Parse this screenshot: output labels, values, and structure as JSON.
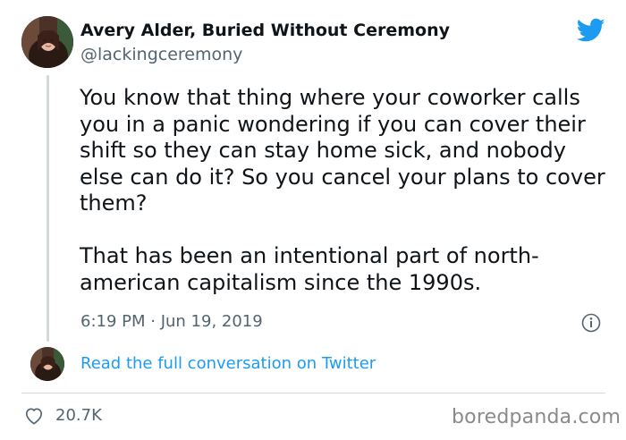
{
  "author": {
    "display_name": "Avery Alder, Buried Without Ceremony",
    "handle": "@lackingceremony"
  },
  "tweet": {
    "paragraphs": [
      "You know that thing where your coworker calls you in a panic wondering if you can cover their shift so they can stay home sick, and nobody else can do it? So you cancel your plans to cover them?",
      "That has been an intentional part of north-american capitalism since the 1990s."
    ],
    "timestamp": "6:19 PM · Jun 19, 2019"
  },
  "conversation_link": "Read the full conversation on Twitter",
  "likes": {
    "count": "20.7K"
  },
  "watermark": "boredpanda.com",
  "icons": {
    "brand": "twitter-bird-icon",
    "info": "info-icon",
    "like": "heart-icon"
  },
  "colors": {
    "twitter_blue": "#1d9bf0",
    "text_primary": "#0f1419",
    "text_secondary": "#536471",
    "divider": "#cfd9de"
  }
}
